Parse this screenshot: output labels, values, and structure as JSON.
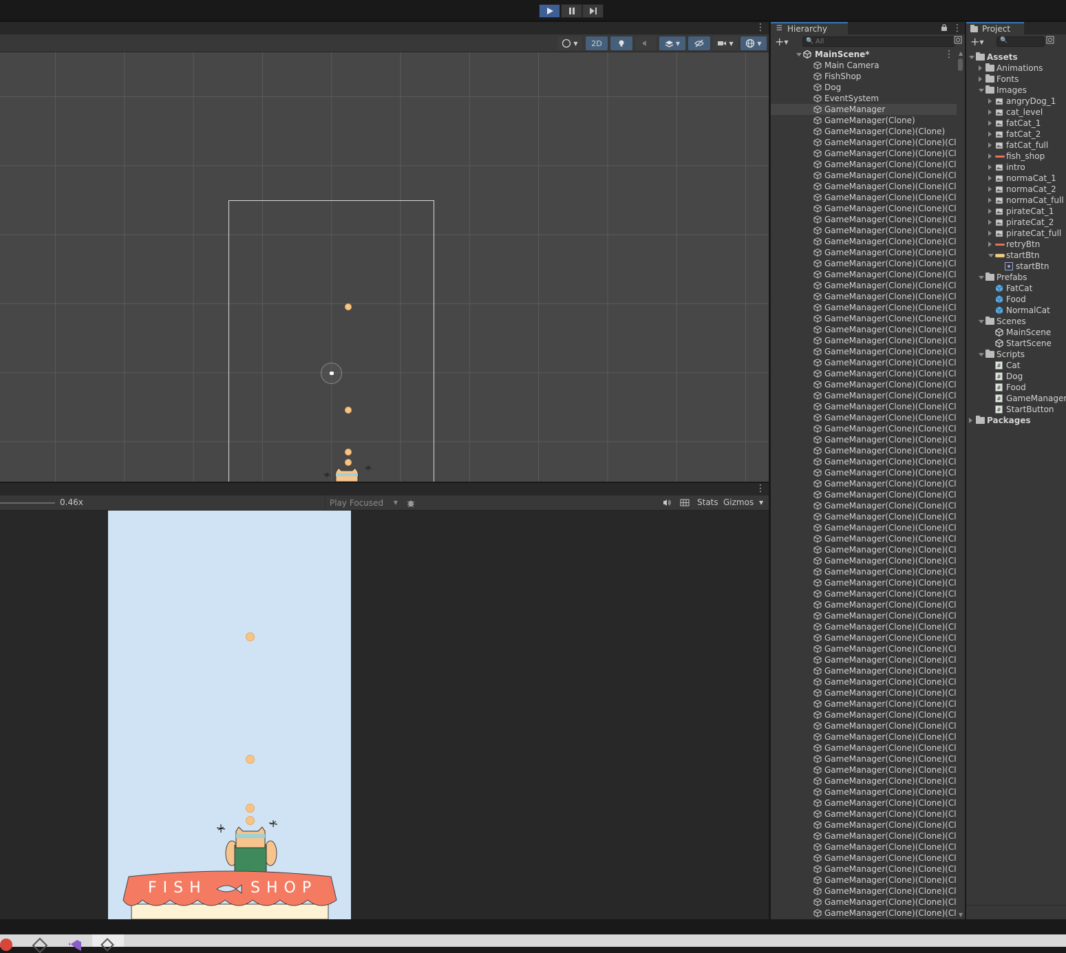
{
  "toolbar": {
    "play": "play-icon",
    "pause": "pause-icon",
    "step": "step-icon"
  },
  "scene": {
    "mode_2d": "2D"
  },
  "game": {
    "zoom": "0.46x",
    "play_mode": "Play Focused",
    "stats": "Stats",
    "gizmos": "Gizmos",
    "shop_left": "FISH",
    "shop_right": "SHOP"
  },
  "hierarchy": {
    "title": "Hierarchy",
    "search_placeholder": "All",
    "scene_name": "MainScene*",
    "items": [
      {
        "label": "Main Camera",
        "selected": false
      },
      {
        "label": "FishShop",
        "selected": false
      },
      {
        "label": "Dog",
        "selected": false
      },
      {
        "label": "EventSystem",
        "selected": false
      },
      {
        "label": "GameManager",
        "selected": true
      },
      {
        "label": "GameManager(Clone)",
        "selected": false
      },
      {
        "label": "GameManager(Clone)(Clone)",
        "selected": false
      }
    ],
    "repeat_label": "GameManager(Clone)(Clone)(Clone)",
    "repeat_count": 71
  },
  "project": {
    "title": "Project",
    "items": [
      {
        "label": "Assets",
        "depth": 0,
        "kind": "folder",
        "open": true,
        "bold": true
      },
      {
        "label": "Animations",
        "depth": 1,
        "kind": "folder",
        "open": false
      },
      {
        "label": "Fonts",
        "depth": 1,
        "kind": "folder",
        "open": false
      },
      {
        "label": "Images",
        "depth": 1,
        "kind": "folder",
        "open": true
      },
      {
        "label": "angryDog_1",
        "depth": 2,
        "kind": "sprite",
        "open": false
      },
      {
        "label": "cat_level",
        "depth": 2,
        "kind": "sprite",
        "open": false
      },
      {
        "label": "fatCat_1",
        "depth": 2,
        "kind": "sprite",
        "open": false
      },
      {
        "label": "fatCat_2",
        "depth": 2,
        "kind": "sprite",
        "open": false
      },
      {
        "label": "fatCat_full",
        "depth": 2,
        "kind": "sprite",
        "open": false
      },
      {
        "label": "fish_shop",
        "depth": 2,
        "kind": "sprite-red",
        "open": false
      },
      {
        "label": "intro",
        "depth": 2,
        "kind": "sprite",
        "open": false
      },
      {
        "label": "normaCat_1",
        "depth": 2,
        "kind": "sprite",
        "open": false
      },
      {
        "label": "normaCat_2",
        "depth": 2,
        "kind": "sprite",
        "open": false
      },
      {
        "label": "normaCat_full",
        "depth": 2,
        "kind": "sprite",
        "open": false
      },
      {
        "label": "pirateCat_1",
        "depth": 2,
        "kind": "sprite",
        "open": false
      },
      {
        "label": "pirateCat_2",
        "depth": 2,
        "kind": "sprite",
        "open": false
      },
      {
        "label": "pirateCat_full",
        "depth": 2,
        "kind": "sprite",
        "open": false
      },
      {
        "label": "retryBtn",
        "depth": 2,
        "kind": "sprite-red",
        "open": false
      },
      {
        "label": "startBtn",
        "depth": 2,
        "kind": "sprite-yellow",
        "open": true
      },
      {
        "label": "startBtn",
        "depth": 3,
        "kind": "subsprite",
        "open": null
      },
      {
        "label": "Prefabs",
        "depth": 1,
        "kind": "folder",
        "open": true
      },
      {
        "label": "FatCat",
        "depth": 2,
        "kind": "prefab",
        "open": null
      },
      {
        "label": "Food",
        "depth": 2,
        "kind": "prefab",
        "open": null
      },
      {
        "label": "NormalCat",
        "depth": 2,
        "kind": "prefab",
        "open": null
      },
      {
        "label": "Scenes",
        "depth": 1,
        "kind": "folder",
        "open": true
      },
      {
        "label": "MainScene",
        "depth": 2,
        "kind": "scene",
        "open": null
      },
      {
        "label": "StartScene",
        "depth": 2,
        "kind": "scene",
        "open": null
      },
      {
        "label": "Scripts",
        "depth": 1,
        "kind": "folder",
        "open": true
      },
      {
        "label": "Cat",
        "depth": 2,
        "kind": "script",
        "open": null
      },
      {
        "label": "Dog",
        "depth": 2,
        "kind": "script",
        "open": null
      },
      {
        "label": "Food",
        "depth": 2,
        "kind": "script",
        "open": null
      },
      {
        "label": "GameManager",
        "depth": 2,
        "kind": "script",
        "open": null
      },
      {
        "label": "StartButton",
        "depth": 2,
        "kind": "script",
        "open": null
      },
      {
        "label": "Packages",
        "depth": 0,
        "kind": "folder",
        "open": false,
        "bold": true
      }
    ]
  },
  "colors": {
    "accent": "#3a79bb",
    "play_active": "#3e5f96",
    "game_bg": "#cfe3f5",
    "shop_awning": "#f47b62",
    "food": "#f6c585"
  }
}
